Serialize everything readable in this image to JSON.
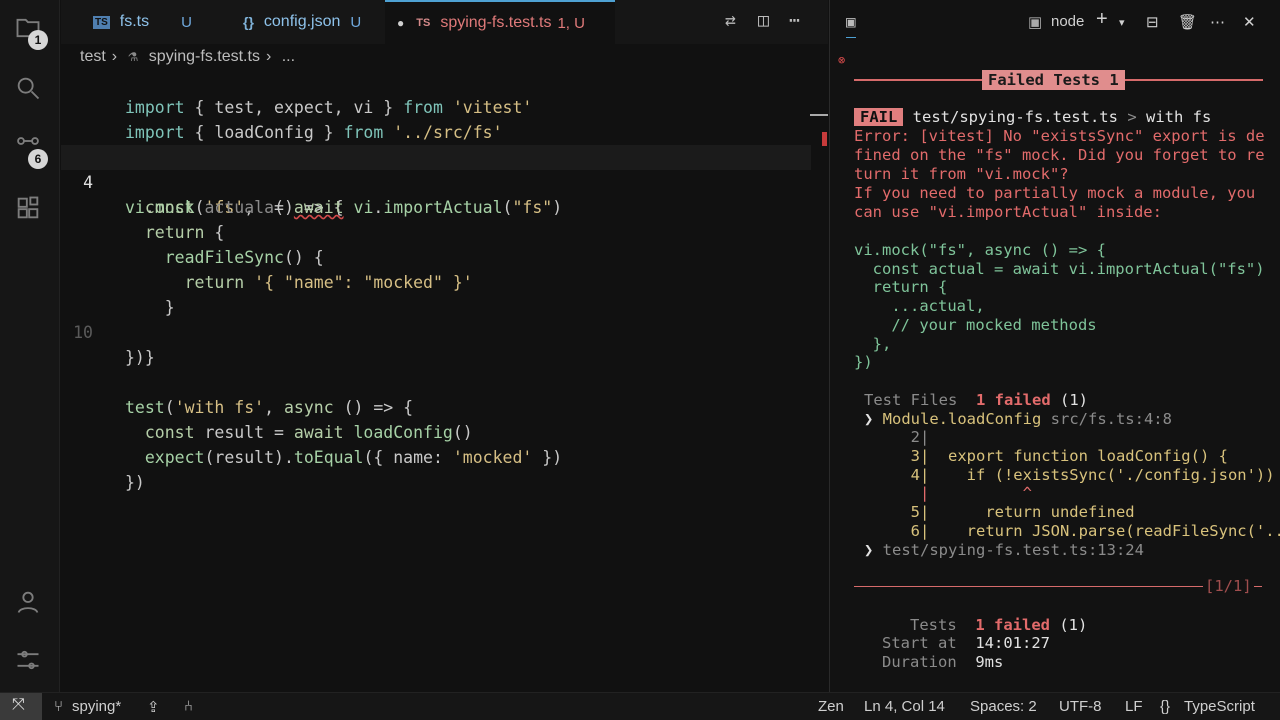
{
  "activity": {
    "explorer_badge": "1",
    "scm_badge": "6"
  },
  "tabs": [
    {
      "icon": "TS",
      "label": "fs.ts",
      "status": "U"
    },
    {
      "icon": "{}",
      "label": "config.json",
      "status": "U"
    },
    {
      "icon": "TS",
      "label": "spying-fs.test.ts",
      "status": "1, U",
      "active": true
    }
  ],
  "breadcrumb": {
    "folder": "test",
    "file": "spying-fs.test.ts",
    "more": "..."
  },
  "editor": {
    "current_line_number": "4",
    "line_number_10": "10",
    "lines": [
      "import { test, expect, vi } from 'vitest'",
      "import { loadConfig } from '../src/fs'",
      "",
      "vi.mock('fs', async () => {",
      "  const actual = await vi.importActual(\"fs\")",
      "  return {",
      "    readFileSync() {",
      "      return '{ \"name\": \"mocked\" }'",
      "    }",
      "  }",
      "})",
      "",
      "test('with fs', async () => {",
      "  const result = await loadConfig()",
      "  expect(result).toEqual({ name: 'mocked' })",
      "})"
    ]
  },
  "panel": {
    "terminal_name": "node",
    "failed_header": "Failed Tests 1",
    "fail_tag": "FAIL",
    "fail_path": "test/spying-fs.test.ts",
    "fail_sep": ">",
    "fail_name": "with fs",
    "error_lines": [
      "Error: [vitest] No \"existsSync\" export is de",
      "fined on the \"fs\" mock. Did you forget to re",
      "turn it from \"vi.mock\"?",
      "If you need to partially mock a module, you",
      "can use \"vi.importActual\" inside:"
    ],
    "hint_lines": [
      "vi.mock(\"fs\", async () => {",
      "  const actual = await vi.importActual(\"fs\")",
      "  return {",
      "    ...actual,",
      "    // your mocked methods",
      "  },",
      "})"
    ],
    "test_files_label": "Test Files",
    "test_files_value": "1 failed",
    "test_files_count": "(1)",
    "trace1_name": "Module.loadConfig",
    "trace1_loc": "src/fs.ts:4:8",
    "snippet": [
      "     2|",
      "     3|  export function loadConfig() {",
      "     4|    if (!existsSync('./config.json'))",
      "      |          ^",
      "     5|      return undefined",
      "     6|    return JSON.parse(readFileSync('..."
    ],
    "trace2": "test/spying-fs.test.ts:13:24",
    "pager": "[1/1]",
    "tests_label": "Tests",
    "tests_value": "1 failed",
    "tests_count": "(1)",
    "start_label": "Start at",
    "start_value": "14:01:27",
    "duration_label": "Duration",
    "duration_value": "9ms"
  },
  "statusbar": {
    "branch": "spying*",
    "zen": "Zen",
    "position": "Ln 4, Col 14",
    "spaces": "Spaces: 2",
    "encoding": "UTF-8",
    "eol": "LF",
    "language": "TypeScript"
  }
}
